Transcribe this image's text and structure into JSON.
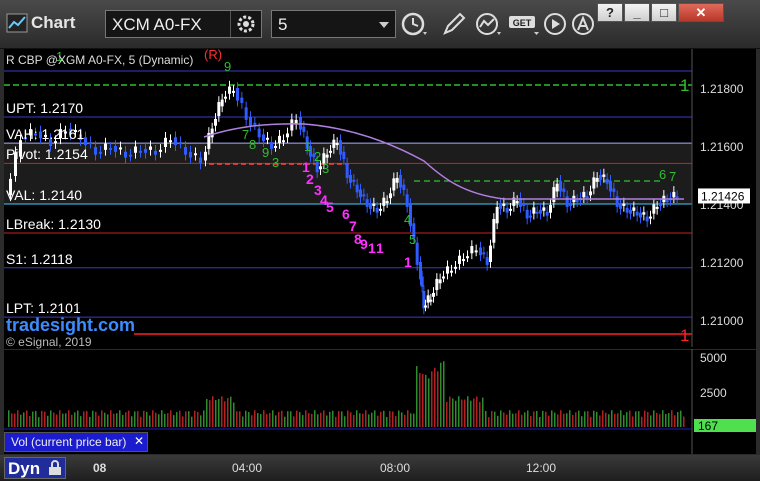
{
  "app": {
    "title": "Chart"
  },
  "toolbar": {
    "symbol": "XCM A0-FX",
    "interval": "5",
    "window_buttons": [
      "?",
      "_",
      "□",
      "✕"
    ]
  },
  "chart": {
    "header": "R CBP @XGM A0-FX, 5 (Dynamic)",
    "levels": [
      {
        "label": "UPT: 1.2170",
        "value": 1.217,
        "color": "#3a3acc"
      },
      {
        "label": "VAH: 1.2161",
        "value": 1.2161,
        "color": "#aaaaff"
      },
      {
        "label": "Pivot: 1.2154",
        "value": 1.2154,
        "color": "#cc2222"
      },
      {
        "label": "VAL: 1.2140",
        "value": 1.214,
        "color": "#40d0ff"
      },
      {
        "label": "LBreak: 1.2130",
        "value": 1.213,
        "color": "#cc2222"
      },
      {
        "label": "S1: 1.2118",
        "value": 1.2118,
        "color": "#3a3acc"
      },
      {
        "label": "LPT: 1.2101",
        "value": 1.2101,
        "color": "#3a3acc"
      }
    ],
    "price_ticks": [
      "1.21800",
      "1.21600",
      "1.21400",
      "1.21200",
      "1.21000"
    ],
    "price_tick_values": [
      1.218,
      1.216,
      1.214,
      1.212,
      1.21
    ],
    "current_price": "1.21426",
    "current_price_value": 1.21426,
    "red_marker": "1",
    "green_marker": "1",
    "watermark": "tradesight.com",
    "copyright": "© eSignal, 2019",
    "seq_magenta": [
      "1",
      "2",
      "3",
      "4",
      "5",
      "6",
      "7",
      "8",
      "9",
      "1",
      "1",
      "1"
    ],
    "seq_green": [
      "7",
      "8",
      "9",
      "3",
      "1",
      "2",
      "3",
      "4",
      "5",
      "6",
      "7"
    ],
    "seq_top": [
      "1",
      "(R)",
      "9"
    ]
  },
  "volume": {
    "title": "Vol (current price bar)",
    "ticks": [
      "5000",
      "2500"
    ],
    "tick_values": [
      5000,
      2500
    ],
    "current": "167"
  },
  "time_axis": {
    "labels": [
      "08",
      "04:00",
      "08:00",
      "12:00"
    ]
  },
  "bottom": {
    "mode": "Dyn"
  },
  "colors": {
    "up_bar": "#ffffff",
    "down_bar": "#2e5cff",
    "vwap": "#b080e0",
    "vol_green": "#2e8b2e",
    "vol_red": "#b22222"
  }
}
